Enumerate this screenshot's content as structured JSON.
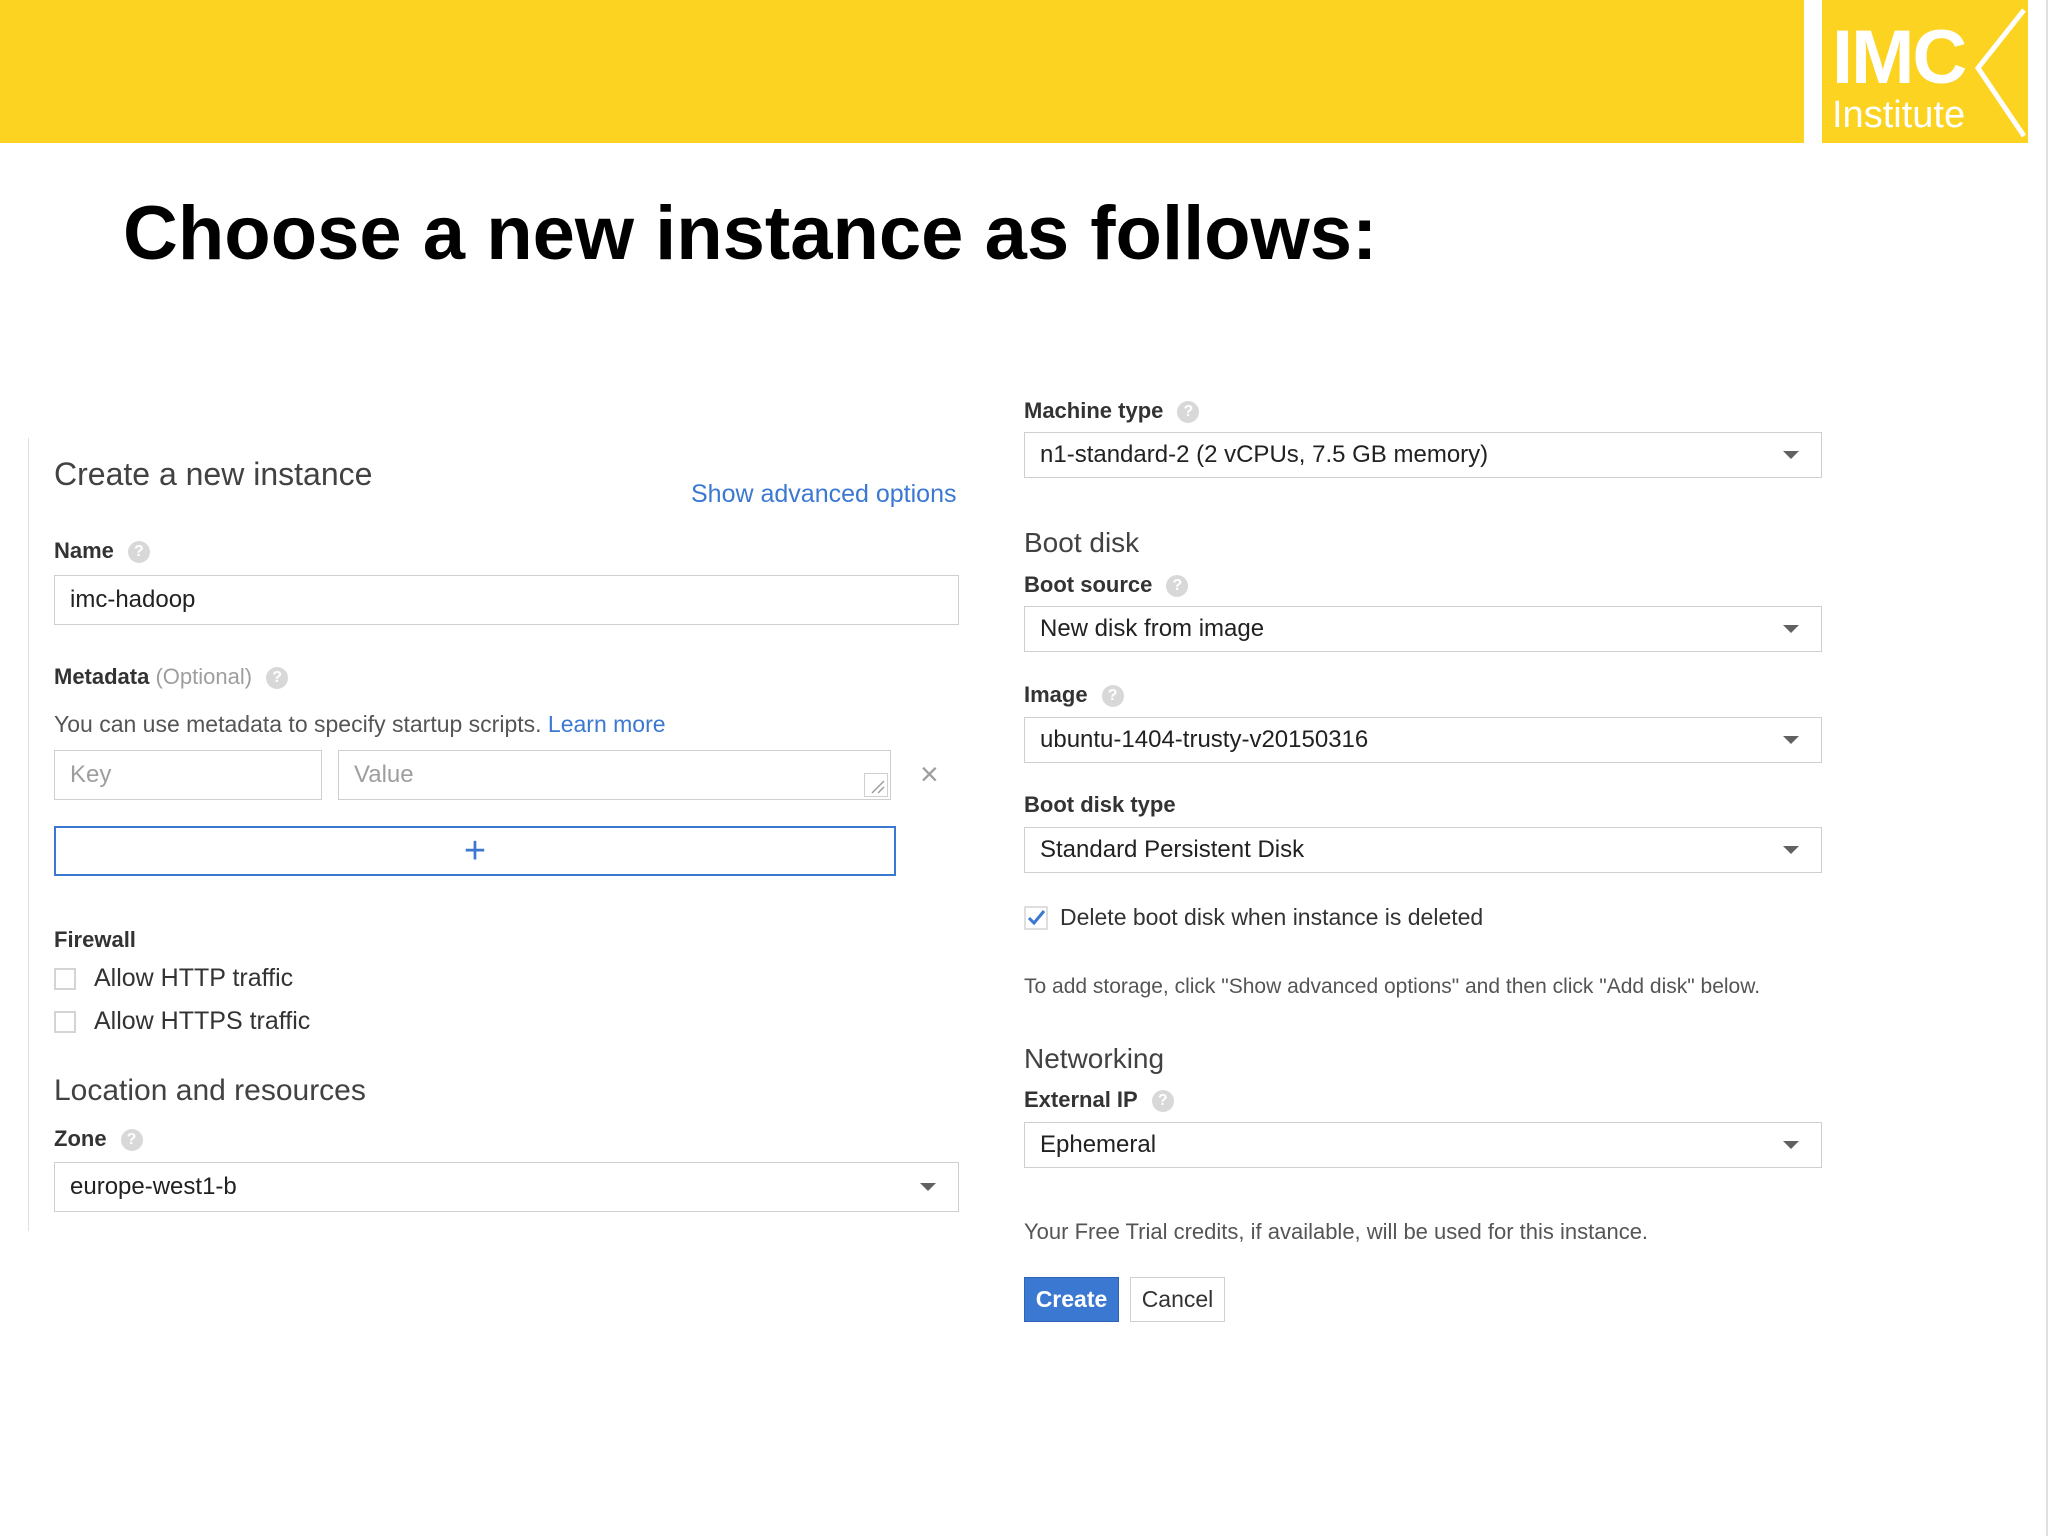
{
  "slide": {
    "title": "Choose a new instance as follows:",
    "logo": {
      "line1": "IMC",
      "line2": "Institute",
      "color": "#fcd321"
    }
  },
  "form": {
    "heading": "Create a new instance",
    "show_advanced": "Show advanced options",
    "name": {
      "label": "Name",
      "value": "imc-hadoop"
    },
    "metadata": {
      "label": "Metadata",
      "optional": "(Optional)",
      "help_text": "You can use metadata to specify startup scripts.",
      "learn_more": "Learn more",
      "key_placeholder": "Key",
      "value_placeholder": "Value",
      "remove_glyph": "×",
      "add_glyph": "+"
    },
    "firewall": {
      "label": "Firewall",
      "options": [
        {
          "label": "Allow HTTP traffic",
          "checked": false
        },
        {
          "label": "Allow HTTPS traffic",
          "checked": false
        }
      ]
    },
    "location": {
      "heading": "Location and resources",
      "zone_label": "Zone",
      "zone_value": "europe-west1-b"
    },
    "machine_type": {
      "label": "Machine type",
      "value": "n1-standard-2 (2 vCPUs, 7.5 GB memory)"
    },
    "boot_disk": {
      "heading": "Boot disk",
      "source_label": "Boot source",
      "source_value": "New disk from image",
      "image_label": "Image",
      "image_value": "ubuntu-1404-trusty-v20150316",
      "type_label": "Boot disk type",
      "type_value": "Standard Persistent Disk",
      "delete_label": "Delete boot disk when instance is deleted",
      "delete_checked": true,
      "storage_note": "To add storage, click \"Show advanced options\" and then click \"Add disk\" below."
    },
    "networking": {
      "heading": "Networking",
      "external_ip_label": "External IP",
      "external_ip_value": "Ephemeral"
    },
    "trial_note": "Your Free Trial credits, if available, will be used for this instance.",
    "create_label": "Create",
    "cancel_label": "Cancel",
    "help_glyph": "?",
    "colors": {
      "primary": "#3b78d1",
      "link": "#3b78d1"
    }
  }
}
